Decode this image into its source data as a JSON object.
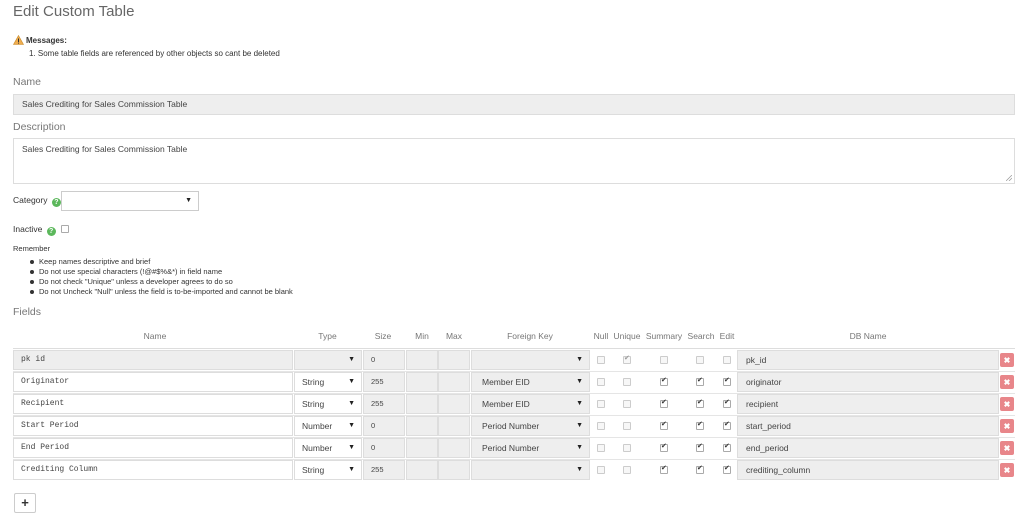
{
  "page": {
    "title": "Edit Custom Table"
  },
  "messages": {
    "heading": "Messages:",
    "items": [
      "1. Some table fields are referenced by other objects so cant be deleted"
    ]
  },
  "form": {
    "name_label": "Name",
    "name_value": "Sales Crediting for Sales Commission Table",
    "description_label": "Description",
    "description_value": "Sales Crediting for Sales Commission Table",
    "category_label": "Category",
    "category_value": "",
    "inactive_label": "Inactive"
  },
  "remember": {
    "heading": "Remember",
    "items": [
      "Keep names descriptive and brief",
      "Do not use special characters (!@#$%&*) in field name",
      "Do not check \"Unique\" unless a developer agrees to do so",
      "Do not Uncheck \"Null\" unless the field is to-be-imported and cannot be blank"
    ]
  },
  "fields_label": "Fields",
  "columns": [
    "Name",
    "Type",
    "Size",
    "Min",
    "Max",
    "Foreign Key",
    "Null",
    "Unique",
    "Summary",
    "Search",
    "Edit",
    "DB Name"
  ],
  "rows": [
    {
      "name": "pk id",
      "type": "",
      "size": "0",
      "fk": "",
      "null": false,
      "unique": true,
      "summary": false,
      "search": false,
      "edit": false,
      "db": "pk_id",
      "locked": true
    },
    {
      "name": "Originator",
      "type": "String",
      "size": "255",
      "fk": "Member EID",
      "null": false,
      "unique": false,
      "summary": true,
      "search": true,
      "edit": true,
      "db": "originator",
      "locked": false
    },
    {
      "name": "Recipient",
      "type": "String",
      "size": "255",
      "fk": "Member EID",
      "null": false,
      "unique": false,
      "summary": true,
      "search": true,
      "edit": true,
      "db": "recipient",
      "locked": false
    },
    {
      "name": "Start Period",
      "type": "Number",
      "size": "0",
      "fk": "Period Number",
      "null": false,
      "unique": false,
      "summary": true,
      "search": true,
      "edit": true,
      "db": "start_period",
      "locked": false
    },
    {
      "name": "End Period",
      "type": "Number",
      "size": "0",
      "fk": "Period Number",
      "null": false,
      "unique": false,
      "summary": true,
      "search": true,
      "edit": true,
      "db": "end_period",
      "locked": false
    },
    {
      "name": "Crediting Column",
      "type": "String",
      "size": "255",
      "fk": "",
      "null": false,
      "unique": false,
      "summary": true,
      "search": true,
      "edit": true,
      "db": "crediting_column",
      "locked": false
    }
  ],
  "icons": {
    "warning": "warning-icon",
    "help": "help-icon",
    "delete": "delete-icon",
    "add": "plus-icon",
    "dropdown": "caret-down-icon"
  },
  "colors": {
    "delete_button": "#e8868a",
    "help_icon": "#5cb85c",
    "warning": "#f0ad4e"
  }
}
